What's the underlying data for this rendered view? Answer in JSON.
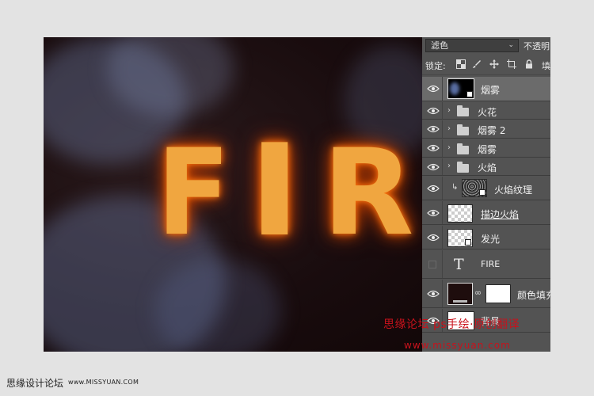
{
  "canvas": {
    "artwork_text": [
      "F",
      "I",
      "R"
    ]
  },
  "layers_panel": {
    "blend_mode": "滤色",
    "opacity_label": "不透明",
    "lock_label": "锁定:",
    "fill_label": "填",
    "layers": [
      {
        "name": "烟雾",
        "type": "smart",
        "selected": true,
        "visible": true
      },
      {
        "name": "火花",
        "type": "group",
        "selected": false,
        "visible": true
      },
      {
        "name": "烟雾 2",
        "type": "group",
        "selected": false,
        "visible": true
      },
      {
        "name": "烟雾",
        "type": "group",
        "selected": false,
        "visible": true
      },
      {
        "name": "火焰",
        "type": "group",
        "selected": false,
        "visible": true
      },
      {
        "name": "火焰纹理",
        "type": "clipped-smart",
        "selected": false,
        "visible": true
      },
      {
        "name": "描边火焰",
        "type": "raster",
        "selected": false,
        "visible": true
      },
      {
        "name": "发光",
        "type": "smart",
        "selected": false,
        "visible": true
      },
      {
        "name": "FIRE",
        "type": "text",
        "selected": false,
        "visible": false
      },
      {
        "name": "颜色填充",
        "type": "fill",
        "selected": false,
        "visible": true
      },
      {
        "name": "背景",
        "type": "background",
        "selected": false,
        "visible": true
      }
    ]
  },
  "watermark": {
    "chinese": "思缘论坛 ps手绘·原创翻译",
    "url": "www.missyuan.com"
  },
  "footer": {
    "site_name": "思缘设计论坛",
    "site_url": "www.MISSYUAN.COM"
  },
  "colors": {
    "accent_watermark": "#c8121c",
    "panel_bg": "#535353",
    "selected_layer_bg": "#6b6b6b",
    "fire": "#f0a640"
  }
}
